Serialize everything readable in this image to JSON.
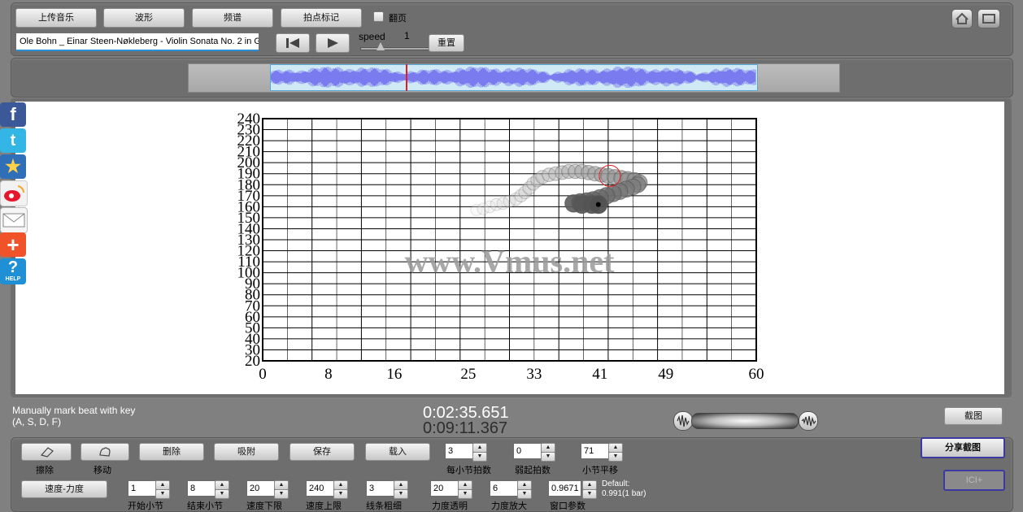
{
  "toolbar": {
    "upload_label": "上传音乐",
    "waveform_label": "波形",
    "spectrum_label": "频谱",
    "beat_mark_label": "拍点标记",
    "flip_label": "翻页",
    "track_title": "Ole Bohn _ Einar Steen-Nøkleberg - Violin Sonata No. 2 in G",
    "speed_label": "speed",
    "speed_value": "1",
    "reset_label": "重置"
  },
  "chart_data": {
    "type": "scatter",
    "title": "",
    "xlabel": "",
    "ylabel": "",
    "xlim": [
      0,
      60
    ],
    "ylim": [
      20,
      240
    ],
    "x_ticks": [
      0,
      8,
      16,
      25,
      33,
      41,
      49,
      60
    ],
    "y_ticks": [
      20,
      30,
      40,
      50,
      60,
      70,
      80,
      90,
      100,
      110,
      120,
      130,
      140,
      150,
      160,
      170,
      180,
      190,
      200,
      210,
      220,
      230,
      240
    ],
    "grid": true,
    "watermark": "www.Vmus.net",
    "series": [
      {
        "points": [
          [
            26.0,
            157
          ],
          [
            26.8,
            158
          ],
          [
            27.6,
            160
          ],
          [
            28.4,
            162
          ],
          [
            29.2,
            163
          ],
          [
            30.0,
            165
          ],
          [
            30.8,
            167
          ],
          [
            31.4,
            170
          ],
          [
            31.9,
            173
          ],
          [
            32.4,
            177
          ],
          [
            32.9,
            181
          ],
          [
            33.4,
            184
          ],
          [
            34.0,
            187
          ],
          [
            34.8,
            189
          ],
          [
            35.6,
            190
          ],
          [
            36.4,
            191
          ],
          [
            37.2,
            192
          ],
          [
            38.0,
            192
          ],
          [
            38.8,
            192
          ],
          [
            39.6,
            191
          ],
          [
            40.4,
            190
          ],
          [
            41.2,
            189
          ],
          [
            42.0,
            188
          ],
          [
            42.8,
            187
          ],
          [
            43.6,
            186
          ],
          [
            44.4,
            185
          ],
          [
            45.2,
            184
          ],
          [
            45.8,
            182
          ],
          [
            45.6,
            180
          ],
          [
            45.0,
            178
          ],
          [
            44.2,
            176
          ],
          [
            43.4,
            174
          ],
          [
            42.6,
            172
          ],
          [
            41.8,
            170
          ],
          [
            41.0,
            168
          ],
          [
            40.2,
            166
          ],
          [
            39.4,
            165
          ],
          [
            38.6,
            164
          ],
          [
            37.8,
            163
          ],
          [
            38.8,
            162
          ],
          [
            40.0,
            162
          ],
          [
            40.8,
            162
          ]
        ]
      }
    ],
    "cursor_marker": [
      42.2,
      188
    ]
  },
  "status": {
    "hint_line1": "Manually mark beat with key",
    "hint_line2": "(A, S, D, F)",
    "time_current": "0:02:35.651",
    "time_total": "0:09:11.367",
    "screenshot_label": "截图"
  },
  "bottom": {
    "erase_label": "擦除",
    "move_label": "移动",
    "delete_label": "删除",
    "snap_label": "吸附",
    "save_label": "保存",
    "load_label": "载入",
    "beats_per_bar_value": "3",
    "beats_per_bar_label": "每小节拍数",
    "pickup_value": "0",
    "pickup_label": "弱起拍数",
    "bar_shift_value": "71",
    "bar_shift_label": "小节平移",
    "share_label": "分享截图",
    "icl_label": "ICI+",
    "speed_force_label": "速度-力度",
    "start_bar_value": "1",
    "start_bar_label": "开始小节",
    "end_bar_value": "8",
    "end_bar_label": "结束小节",
    "speed_min_value": "20",
    "speed_min_label": "速度下限",
    "speed_max_value": "240",
    "speed_max_label": "速度上限",
    "line_width_value": "3",
    "line_width_label": "线条粗细",
    "force_alpha_value": "20",
    "force_alpha_label": "力度透明",
    "force_scale_value": "6",
    "force_scale_label": "力度放大",
    "window_param_value": "0.9671",
    "window_param_label": "窗口参数",
    "default_line1": "Default:",
    "default_line2": "0.991(1 bar)"
  },
  "social": {
    "icons": [
      "facebook-icon",
      "twitter-icon",
      "favorite-star-icon",
      "weibo-icon",
      "mail-icon",
      "add-share-icon",
      "help-icon"
    ],
    "help_text": "HELP"
  },
  "colors": {
    "waveform": "#7b7bf0",
    "selection": "#cfeaf5",
    "cursor": "#e02020",
    "accent_border": "#3a3aa0"
  }
}
